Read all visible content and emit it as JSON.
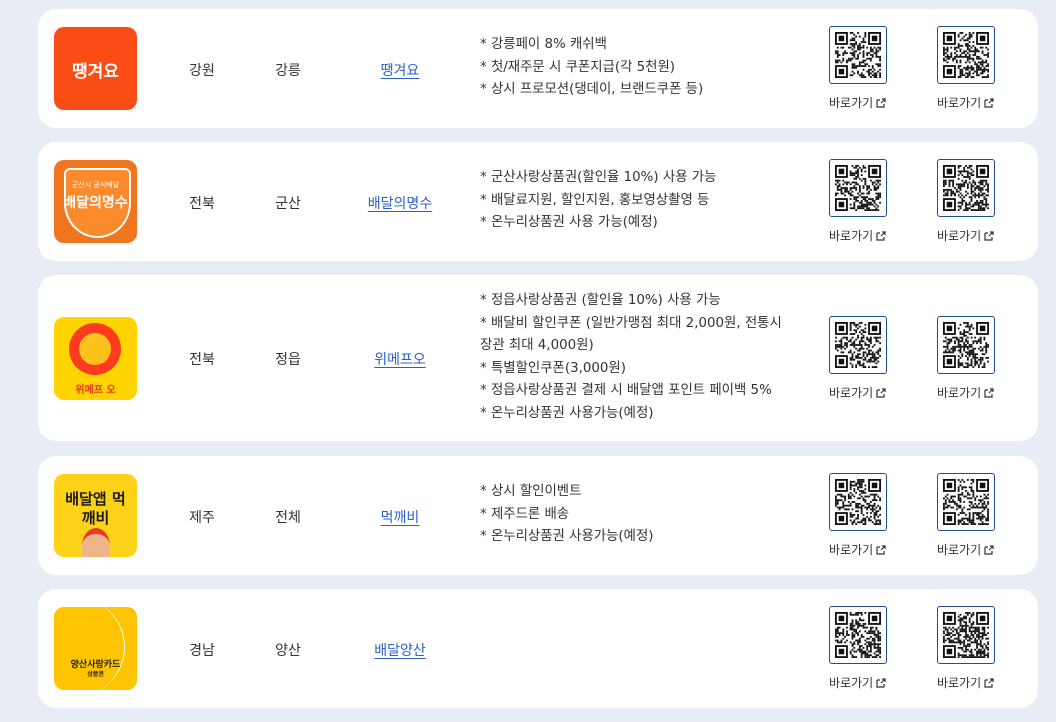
{
  "goto_label": "바로가기",
  "rows": [
    {
      "region": "강원",
      "city": "강릉",
      "app": "땡겨요",
      "logo_text": "땡겨요",
      "benefits": [
        "* 강릉페이 8% 캐쉬백",
        "* 첫/재주문 시 쿠폰지급(각 5천원)",
        "* 상시 프로모션(댕데이, 브랜드쿠폰 등)"
      ]
    },
    {
      "region": "전북",
      "city": "군산",
      "app": "배달의명수",
      "logo_text": "배달의명수",
      "logo_subtext": "군산시 공식배달",
      "benefits": [
        "* 군산사랑상품권(할인율 10%) 사용 가능",
        "* 배달료지원, 할인지원, 홍보영상촬영 등",
        "* 온누리상품권 사용 가능(예정)"
      ]
    },
    {
      "region": "전북",
      "city": "정읍",
      "app": "위메프오",
      "logo_text": "위메프 오",
      "benefits": [
        "* 정읍사랑상품권 (할인율 10%) 사용 가능",
        "* 배달비 할인쿠폰 (일반가맹점 최대 2,000원, 전통시장관 최대 4,000원)",
        "* 특별할인쿠폰(3,000원)",
        "* 정읍사랑상품권 결제 시 배달앱 포인트 페이백 5%",
        "* 온누리상품권 사용가능(예정)"
      ]
    },
    {
      "region": "제주",
      "city": "전체",
      "app": "먹깨비",
      "logo_text": "배달앱 먹깨비",
      "benefits": [
        "* 상시 할인이벤트",
        "* 제주드론 배송",
        "* 온누리상품권 사용가능(예정)"
      ]
    },
    {
      "region": "경남",
      "city": "양산",
      "app": "배달양산",
      "logo_text": "양산사랑카드",
      "logo_subtext": "상품권",
      "benefits": []
    }
  ]
}
